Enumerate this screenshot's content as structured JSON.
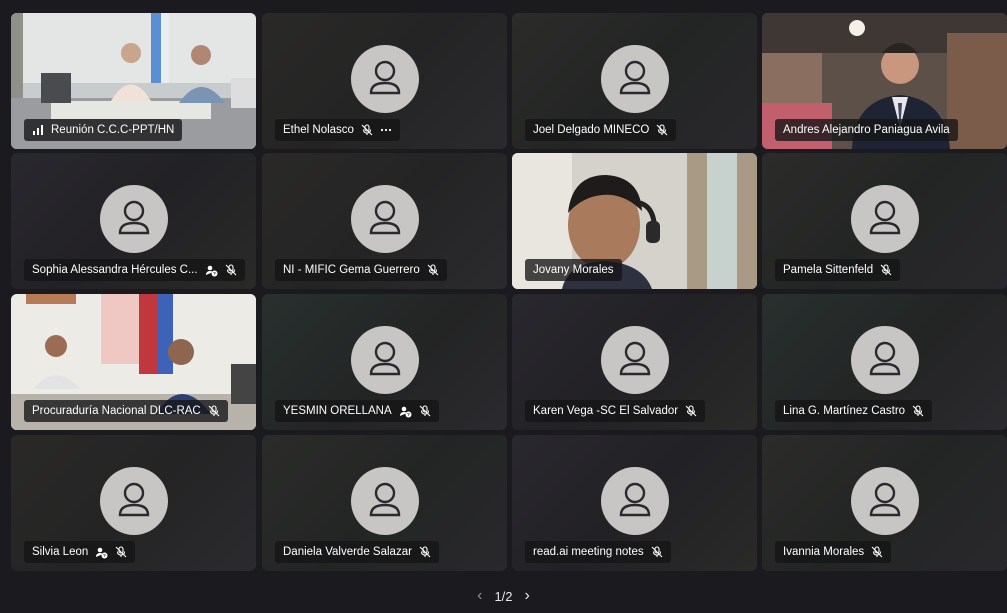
{
  "participants": [
    {
      "name": "Reunión C.C.C-PPT/HN",
      "signal": true,
      "muted": false,
      "more": false,
      "raise": false
    },
    {
      "name": "Ethel Nolasco",
      "muted": true,
      "more": true,
      "raise": false
    },
    {
      "name": "Joel Delgado MINECO",
      "muted": true,
      "more": false,
      "raise": false
    },
    {
      "name": "Andres Alejandro Paniagua Avila",
      "muted": false,
      "more": false,
      "raise": false
    },
    {
      "name": "Sophia Alessandra Hércules C...",
      "muted": true,
      "more": false,
      "raise": true
    },
    {
      "name": "NI - MIFIC Gema Guerrero",
      "muted": true,
      "more": false,
      "raise": false
    },
    {
      "name": "Jovany Morales",
      "muted": false,
      "more": false,
      "raise": false
    },
    {
      "name": "Pamela Sittenfeld",
      "muted": true,
      "more": false,
      "raise": false
    },
    {
      "name": "Procuraduría Nacional DLC-RAC",
      "muted": true,
      "more": false,
      "raise": false
    },
    {
      "name": "YESMIN ORELLANA",
      "muted": true,
      "more": false,
      "raise": true
    },
    {
      "name": "Karen Vega -SC El Salvador",
      "muted": true,
      "more": false,
      "raise": false
    },
    {
      "name": "Lina G. Martínez Castro",
      "muted": true,
      "more": false,
      "raise": false
    },
    {
      "name": "Silvia Leon",
      "muted": true,
      "more": false,
      "raise": true
    },
    {
      "name": "Daniela Valverde Salazar",
      "muted": true,
      "more": false,
      "raise": false
    },
    {
      "name": "read.ai meeting notes",
      "muted": true,
      "more": false,
      "raise": false
    },
    {
      "name": "Ivannia Morales",
      "muted": true,
      "more": false,
      "raise": false
    }
  ],
  "pager": {
    "label": "1/2",
    "prev": "‹",
    "next": "›"
  },
  "icons": {
    "mic_off": "mic-off-icon",
    "more": "more-icon",
    "raise_hand": "raise-hand-icon",
    "signal": "signal-bars-icon",
    "avatar": "person-avatar-icon"
  },
  "colors": {
    "background": "#1b1a1e",
    "tile": "#2a292d",
    "avatar": "#c8c6c4",
    "label_bg": "#141416"
  }
}
